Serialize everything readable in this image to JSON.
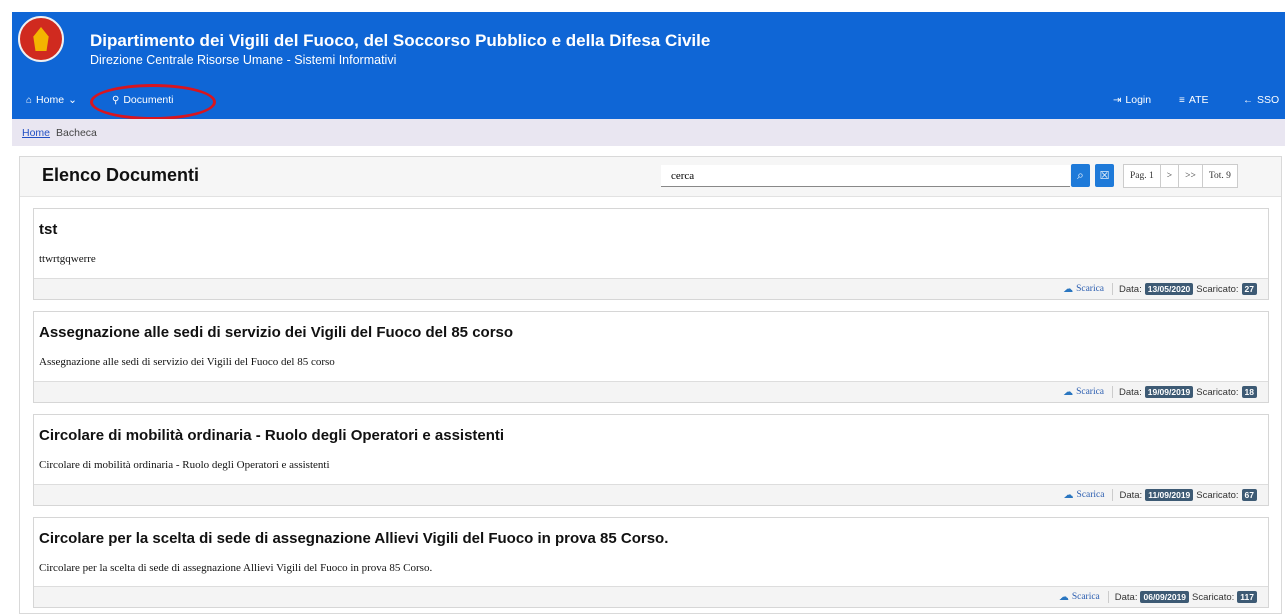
{
  "header": {
    "title": "Dipartimento dei Vigili del Fuoco, del Soccorso Pubblico e della Difesa Civile",
    "subtitle": "Direzione Centrale Risorse Umane - Sistemi Informativi",
    "logo_text": "VIGILI DEL FUOCO CORPO NAZIONALE"
  },
  "nav": {
    "home": "Home",
    "home_caret": "⌄",
    "documenti": "Documenti",
    "login": "Login",
    "ate": "ATE",
    "sso": "SSO"
  },
  "breadcrumb": {
    "home": "Home",
    "current": "Bacheca"
  },
  "panel": {
    "title": "Elenco Documenti",
    "search_value": "cerca",
    "pager": {
      "page": "Pag. 1",
      "next": ">",
      "last": ">>",
      "total": "Tot. 9"
    }
  },
  "documents": [
    {
      "title": "tst",
      "description": "ttwrtgqwerre",
      "download": "Scarica",
      "date_label": "Data:",
      "date": "13/05/2020",
      "count_label": "Scaricato:",
      "count": "27"
    },
    {
      "title": "Assegnazione alle sedi di servizio dei Vigili del Fuoco del 85 corso",
      "description": "Assegnazione alle sedi di servizio dei Vigili del Fuoco del 85 corso",
      "download": "Scarica",
      "date_label": "Data:",
      "date": "19/09/2019",
      "count_label": "Scaricato:",
      "count": "18"
    },
    {
      "title": "Circolare di mobilità ordinaria - Ruolo degli Operatori e assistenti",
      "description": "Circolare di mobilità ordinaria - Ruolo degli Operatori e assistenti",
      "download": "Scarica",
      "date_label": "Data:",
      "date": "11/09/2019",
      "count_label": "Scaricato:",
      "count": "67"
    },
    {
      "title": "Circolare per la scelta di sede di assegnazione Allievi Vigili del Fuoco in prova 85 Corso.",
      "description": "Circolare per la scelta di sede di assegnazione Allievi Vigili del Fuoco in prova 85 Corso.",
      "download": "Scarica",
      "date_label": "Data:",
      "date": "06/09/2019",
      "count_label": "Scaricato:",
      "count": "117"
    }
  ],
  "colors": {
    "header_blue": "#0f66d6",
    "breadcrumb_bg": "#e9e6f1",
    "badge": "#3d5a74",
    "highlight_ring": "#d8151f"
  }
}
